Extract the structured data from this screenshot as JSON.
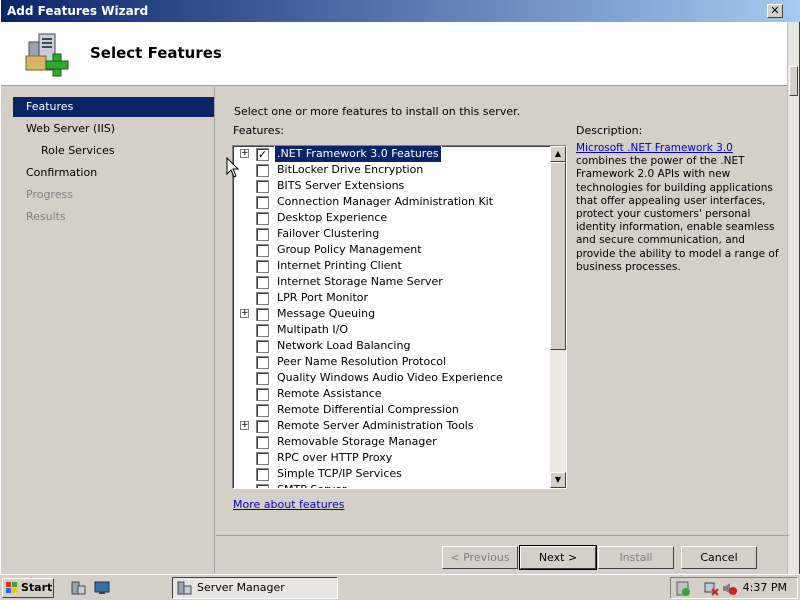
{
  "window": {
    "title": "Add Features Wizard",
    "close_glyph": "✕"
  },
  "header": {
    "title": "Select Features",
    "icon": "server-features-icon"
  },
  "nav": {
    "items": [
      {
        "label": "Features",
        "state": "active"
      },
      {
        "label": "Web Server (IIS)",
        "state": "normal"
      },
      {
        "label": "Role Services",
        "state": "normal"
      },
      {
        "label": "Confirmation",
        "state": "normal"
      },
      {
        "label": "Progress",
        "state": "disabled"
      },
      {
        "label": "Results",
        "state": "disabled"
      }
    ]
  },
  "content": {
    "instruction": "Select one or more features to install on this server.",
    "features_label": "Features:",
    "features": [
      {
        "label": ".NET Framework 3.0 Features",
        "checked": true,
        "expandable": true,
        "selected": true
      },
      {
        "label": "BitLocker Drive Encryption",
        "checked": false,
        "expandable": false
      },
      {
        "label": "BITS Server Extensions",
        "checked": false,
        "expandable": false
      },
      {
        "label": "Connection Manager Administration Kit",
        "checked": false,
        "expandable": false
      },
      {
        "label": "Desktop Experience",
        "checked": false,
        "expandable": false
      },
      {
        "label": "Failover Clustering",
        "checked": false,
        "expandable": false
      },
      {
        "label": "Group Policy Management",
        "checked": false,
        "expandable": false
      },
      {
        "label": "Internet Printing Client",
        "checked": false,
        "expandable": false
      },
      {
        "label": "Internet Storage Name Server",
        "checked": false,
        "expandable": false
      },
      {
        "label": "LPR Port Monitor",
        "checked": false,
        "expandable": false
      },
      {
        "label": "Message Queuing",
        "checked": false,
        "expandable": true
      },
      {
        "label": "Multipath I/O",
        "checked": false,
        "expandable": false
      },
      {
        "label": "Network Load Balancing",
        "checked": false,
        "expandable": false
      },
      {
        "label": "Peer Name Resolution Protocol",
        "checked": false,
        "expandable": false
      },
      {
        "label": "Quality Windows Audio Video Experience",
        "checked": false,
        "expandable": false
      },
      {
        "label": "Remote Assistance",
        "checked": false,
        "expandable": false
      },
      {
        "label": "Remote Differential Compression",
        "checked": false,
        "expandable": false
      },
      {
        "label": "Remote Server Administration Tools",
        "checked": false,
        "expandable": true
      },
      {
        "label": "Removable Storage Manager",
        "checked": false,
        "expandable": false
      },
      {
        "label": "RPC over HTTP Proxy",
        "checked": false,
        "expandable": false
      },
      {
        "label": "Simple TCP/IP Services",
        "checked": false,
        "expandable": false
      },
      {
        "label": "SMTP Server",
        "checked": false,
        "expandable": false
      }
    ],
    "more_link": "More about features",
    "description_label": "Description:",
    "description_link": "Microsoft .NET Framework 3.0",
    "description_text": " combines the power of the .NET Framework 2.0 APIs with new technologies for building applications that offer appealing user interfaces, protect your customers' personal identity information, enable seamless and secure communication, and provide the ability to model a range of business processes."
  },
  "buttons": {
    "previous": "< Previous",
    "next": "Next >",
    "install": "Install",
    "cancel": "Cancel"
  },
  "taskbar": {
    "start_label": "Start",
    "task_label": "Server Manager",
    "clock": "4:37 PM"
  },
  "colors": {
    "selection": "#0a246a",
    "link": "#0000cc",
    "face": "#d4d0c8"
  }
}
